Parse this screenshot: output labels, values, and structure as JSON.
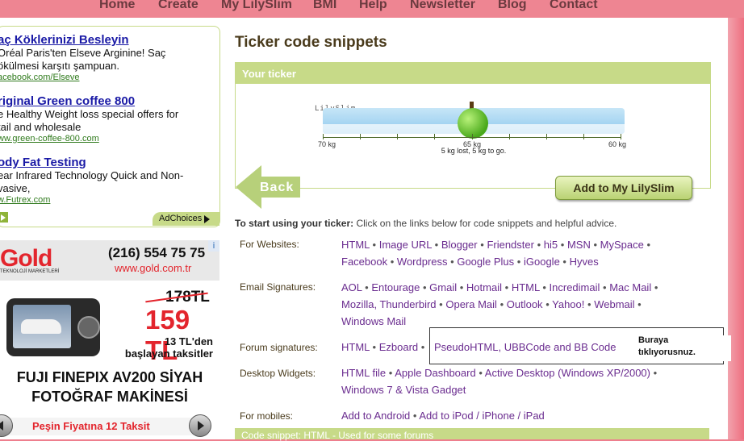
{
  "nav": {
    "items": [
      "Home",
      "Create",
      "My LilySlim",
      "BMI",
      "Help",
      "Newsletter",
      "Blog",
      "Contact"
    ]
  },
  "ads": {
    "items": [
      {
        "title": "aç Köklerinizi Besleyin",
        "lines": [
          "Oréal Paris'ten Elseve Arginine! Saç",
          "ökülmesi karşıtı şampuan."
        ],
        "url": "acebook.com/Elseve"
      },
      {
        "title": "riginal Green coffee 800",
        "lines": [
          "e Healthy Weight loss special offers for",
          "tail and wholesale"
        ],
        "url": "ww.green-coffee-800.com"
      },
      {
        "title": "ody Fat Testing",
        "lines": [
          "ear Infrared Technology Quick and Non-",
          "vasive,"
        ],
        "url": "w.Futrex.com"
      }
    ],
    "adchoices": "AdChoices"
  },
  "banner": {
    "logo": "Gold",
    "logo_sub": "TEKNOLOJİ MARKETLERİ",
    "phone": "(216) 554 75 75",
    "site": "www.gold.com.tr",
    "old_price": "178TL",
    "new_price": "159 TL",
    "promo": "13 TL'den başlayan taksitler",
    "product_line1": "FUJI FINEPIX AV200 SİYAH",
    "product_line2": "FOTOĞRAF MAKİNESİ",
    "installment": "Peşin Fiyatına 12 Taksit",
    "info": "i"
  },
  "main": {
    "title": "Ticker code snippets",
    "your_ticker": "Your ticker",
    "ticker_brand": "LilySlim",
    "ticker_start": "70 kg",
    "ticker_mid": "65 kg",
    "ticker_end": "60 kg",
    "ticker_note": "5 kg lost, 5 kg to go.",
    "ticker_progress": 0.5,
    "back_label": "Back",
    "add_label": "Add to My LilySlim",
    "intro_bold": "To start using your ticker:",
    "intro_rest": " Click on the links below for code snippets and helpful advice."
  },
  "rows": {
    "websites": {
      "label": "For Websites:",
      "links": [
        "HTML",
        "Image URL",
        "Blogger",
        "Friendster",
        "hi5",
        "MSN",
        "MySpace",
        "Facebook",
        "Wordpress",
        "Google Plus",
        "iGoogle",
        "Hyves"
      ]
    },
    "email": {
      "label": "Email Signatures:",
      "links": [
        "AOL",
        "Entourage",
        "Gmail",
        "Hotmail",
        "HTML",
        "Incredimail",
        "Mac Mail",
        "Mozilla, Thunderbird",
        "Opera Mail",
        "Outlook",
        "Yahoo!",
        "Webmail",
        "Windows Mail"
      ]
    },
    "forum": {
      "label": "Forum signatures:",
      "links": [
        "HTML",
        "Ezboard"
      ]
    },
    "desktop": {
      "label": "Desktop Widgets:",
      "links": [
        "HTML file",
        "Apple Dashboard",
        "Active Desktop (Windows XP/2000)",
        "Windows 7 & Vista Gadget"
      ]
    },
    "mobile": {
      "label": "For mobiles:",
      "links": [
        "Add to Android",
        "Add to iPod / iPhone / iPad"
      ]
    }
  },
  "callout": {
    "link": "PseudoHTML, UBBCode and BB Code",
    "note": "Buraya tıklıyorusnuz."
  },
  "code_bar": "Code snippet: HTML - Used for some forums"
}
